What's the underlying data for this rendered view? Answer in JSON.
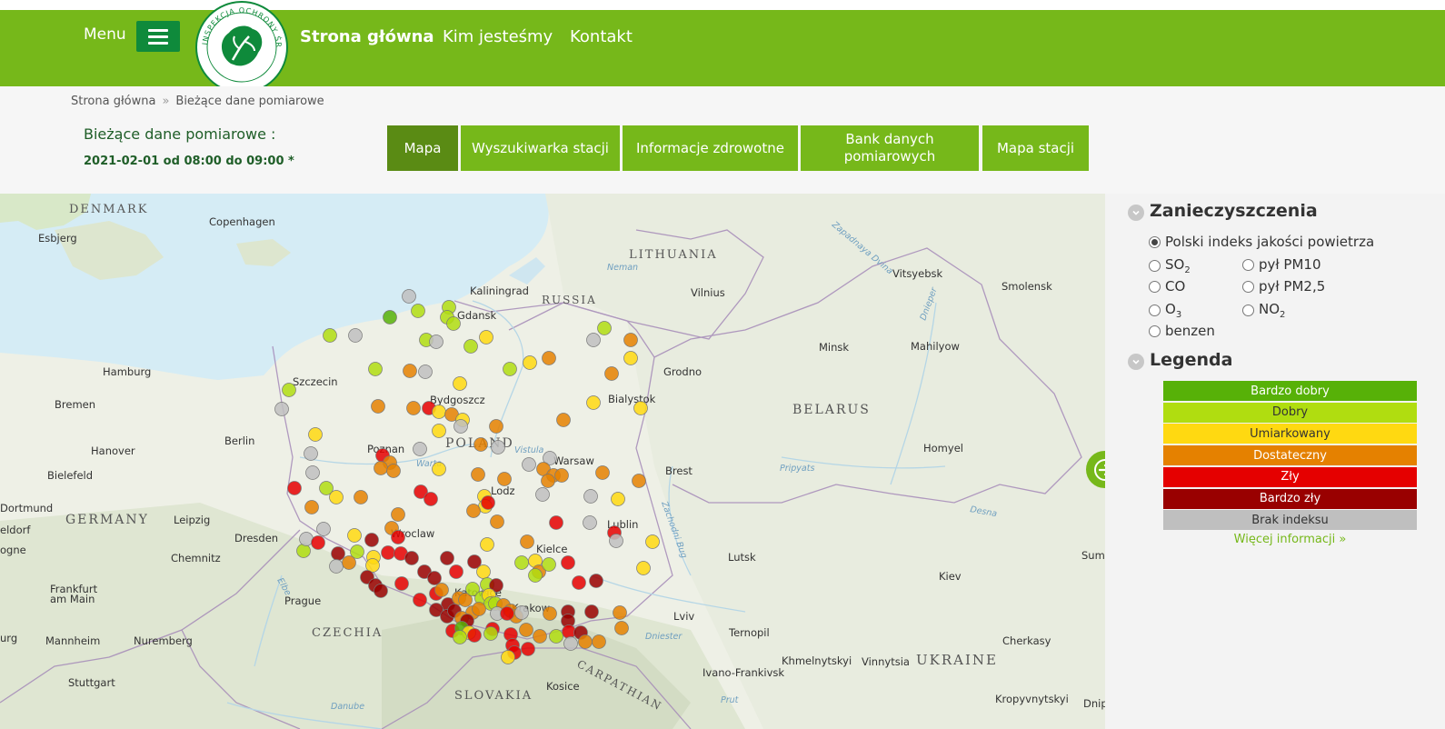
{
  "header": {
    "menu_label": "Menu",
    "logo_text": "INSPEKCJA OCHRONY ŚRODOWISKA",
    "nav": [
      "Strona główna",
      "Kim jesteśmy",
      "Kontakt"
    ]
  },
  "breadcrumb": {
    "home": "Strona główna",
    "separator": "»",
    "current": "Bieżące dane pomiarowe"
  },
  "page": {
    "title": "Bieżące dane pomiarowe :",
    "date": "2021-02-01 od 08:00 do 09:00 *"
  },
  "tabs": [
    {
      "label": "Mapa",
      "active": true
    },
    {
      "label": "Wyszukiwarka stacji",
      "active": false
    },
    {
      "label": "Informacje zdrowotne",
      "active": false
    },
    {
      "label": "Bank danych pomiarowych",
      "active": false
    },
    {
      "label": "Mapa stacji",
      "active": false
    }
  ],
  "pollutants": {
    "title": "Zanieczyszczenia",
    "options": [
      {
        "label": "Polski indeks jakości powietrza",
        "checked": true
      },
      {
        "label": "SO",
        "sub": "2",
        "checked": false
      },
      {
        "label": "pył PM10",
        "checked": false
      },
      {
        "label": "CO",
        "checked": false
      },
      {
        "label": "pył PM2,5",
        "checked": false
      },
      {
        "label": "O",
        "sub": "3",
        "checked": false
      },
      {
        "label": "NO",
        "sub": "2",
        "checked": false
      },
      {
        "label": "benzen",
        "checked": false
      }
    ]
  },
  "legend": {
    "title": "Legenda",
    "items": [
      {
        "label": "Bardzo dobry",
        "color": "#57b108",
        "text": "#ffffff"
      },
      {
        "label": "Dobry",
        "color": "#b0dd10",
        "text": "#333333"
      },
      {
        "label": "Umiarkowany",
        "color": "#ffd911",
        "text": "#333333"
      },
      {
        "label": "Dostateczny",
        "color": "#e58100",
        "text": "#ffffff"
      },
      {
        "label": "Zły",
        "color": "#e50000",
        "text": "#ffffff"
      },
      {
        "label": "Bardzo zły",
        "color": "#990000",
        "text": "#ffffff"
      },
      {
        "label": "Brak indeksu",
        "color": "#bfbfbf",
        "text": "#333333"
      }
    ],
    "more_link": "Więcej informacji »"
  },
  "map": {
    "country_labels": [
      "DENMARK",
      "LITHUANIA",
      "RUSSIA",
      "BELARUS",
      "POLAND",
      "GERMANY",
      "CZECHIA",
      "SLOVAKIA",
      "UKRAINE",
      "CARPATHIAN"
    ],
    "city_labels": [
      "Copenhagen",
      "Esbjerg",
      "Kaliningrad",
      "Vilnius",
      "Vitsyebsk",
      "Smolensk",
      "Gdansk",
      "Hamburg",
      "Szczecin",
      "Bremen",
      "Bydgoszcz",
      "Grodno",
      "Minsk",
      "Mahilyow",
      "Bialystok",
      "Hanover",
      "Berlin",
      "Poznan",
      "Warsaw",
      "Bielefeld",
      "Homyel",
      "Brest",
      "Dortmund",
      "Lodz",
      "Leipzig",
      "Wroclaw",
      "Lublin",
      "Dresden",
      "Kielce",
      "Chemnitz",
      "Lutsk",
      "Frankfurt am Main",
      "Prague",
      "Katowice",
      "Krakow",
      "Lviv",
      "Kiev",
      "Ternopil",
      "Mannheim",
      "Nuremberg",
      "Cherkasy",
      "Khmelnytskyi",
      "Vinnytsia",
      "Ivano-Frankivsk",
      "Stuttgart",
      "Kosice",
      "Kropyvnytskyi",
      "Sum",
      "Dnip",
      "eldorf",
      "ogne",
      "urg"
    ],
    "water_labels": [
      "Neman",
      "Zapadnaya Dvina",
      "Dnieper",
      "Desna",
      "Pripyats",
      "Zachodni Bug",
      "Vistula",
      "Warta",
      "Elbe",
      "Danube",
      "Prut",
      "Dniester"
    ]
  }
}
